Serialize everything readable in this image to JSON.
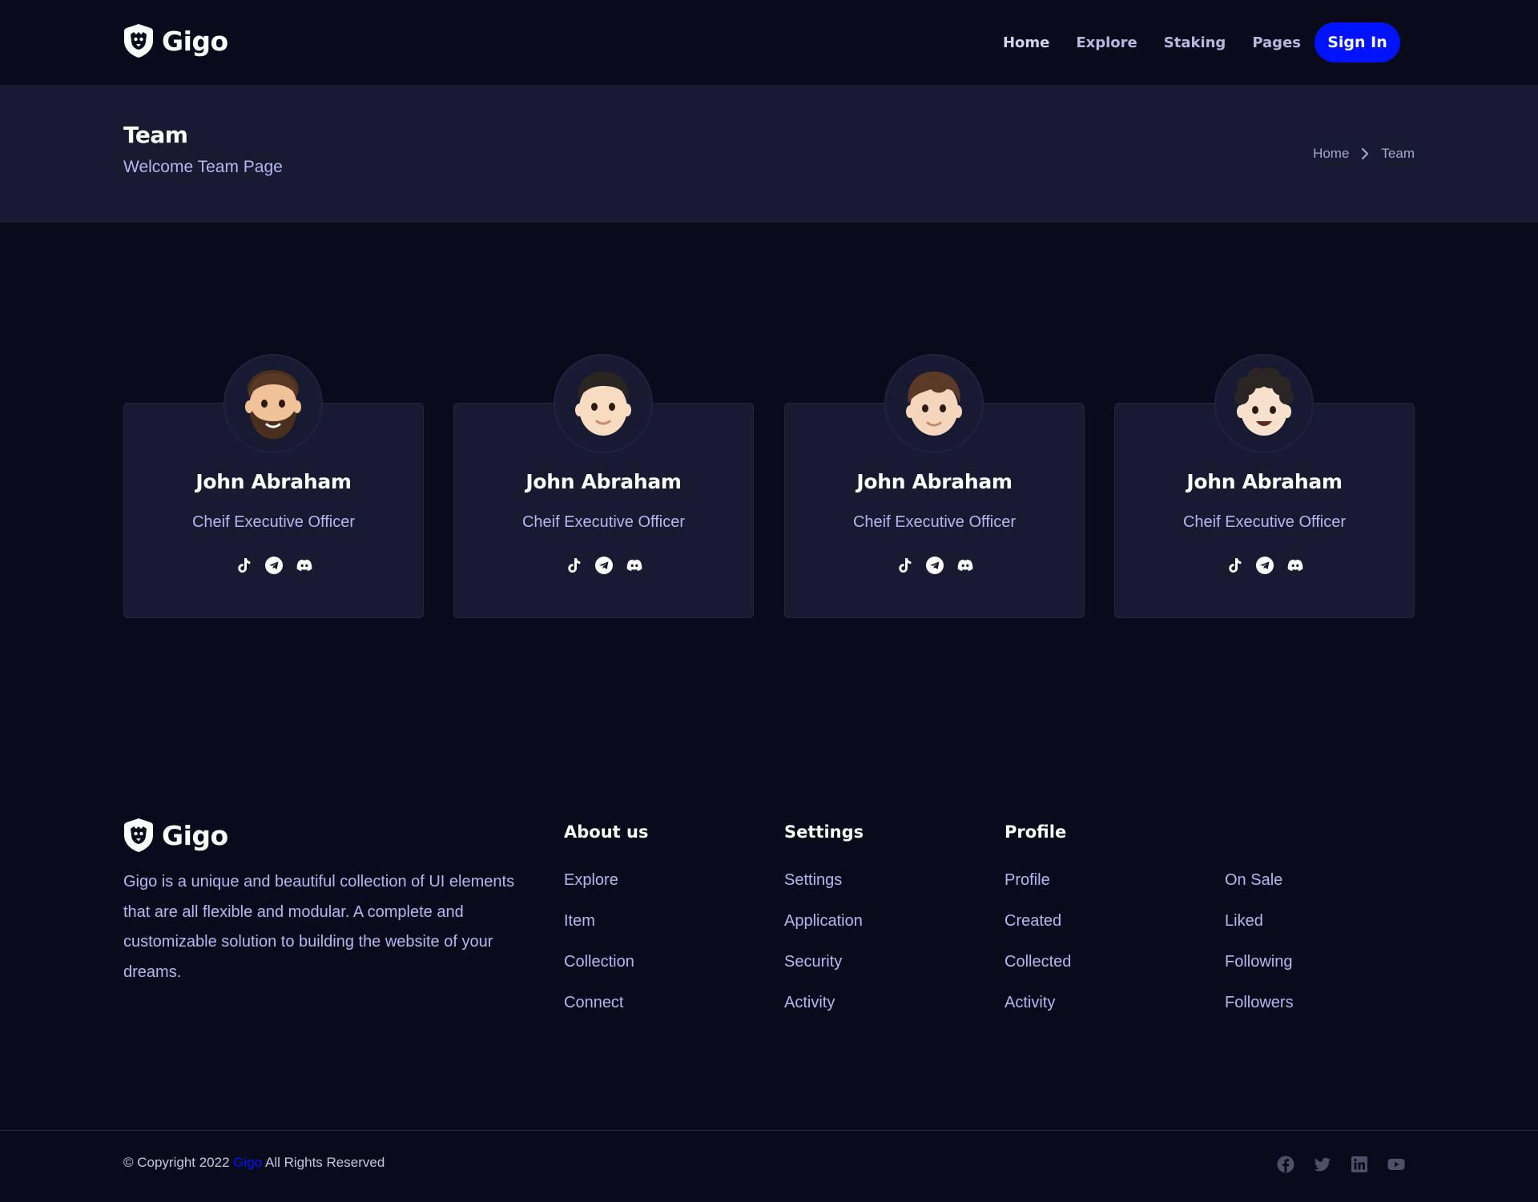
{
  "brand": {
    "name": "Gigo",
    "logo_icon": "lion-shield-icon"
  },
  "nav": {
    "items": [
      {
        "label": "Home"
      },
      {
        "label": "Explore"
      },
      {
        "label": "Staking"
      },
      {
        "label": "Pages"
      }
    ],
    "signin_label": "Sign In"
  },
  "banner": {
    "title": "Team",
    "subtitle": "Welcome Team Page",
    "breadcrumb": [
      "Home",
      "Team"
    ]
  },
  "team": {
    "members": [
      {
        "name": "John Abraham",
        "role": "Cheif Executive Officer",
        "avatar": "bearded-man-emoji",
        "socials": [
          "tiktok-icon",
          "telegram-icon",
          "discord-icon"
        ]
      },
      {
        "name": "John Abraham",
        "role": "Cheif Executive Officer",
        "avatar": "man-emoji",
        "socials": [
          "tiktok-icon",
          "telegram-icon",
          "discord-icon"
        ]
      },
      {
        "name": "John Abraham",
        "role": "Cheif Executive Officer",
        "avatar": "boy-emoji",
        "socials": [
          "tiktok-icon",
          "telegram-icon",
          "discord-icon"
        ]
      },
      {
        "name": "John Abraham",
        "role": "Cheif Executive Officer",
        "avatar": "curly-man-emoji",
        "socials": [
          "tiktok-icon",
          "telegram-icon",
          "discord-icon"
        ]
      }
    ]
  },
  "footer": {
    "description": "Gigo is a unique and beautiful collection of UI elements that are all flexible and modular. A complete and customizable solution to building the website of your dreams.",
    "columns": [
      {
        "title": "About us",
        "links": [
          "Explore",
          "Item",
          "Collection",
          "Connect"
        ]
      },
      {
        "title": "Settings",
        "links": [
          "Settings",
          "Application",
          "Security",
          "Activity"
        ]
      },
      {
        "title": "Profile",
        "links": [
          "Profile",
          "Created",
          "Collected",
          "Activity"
        ]
      },
      {
        "title": "",
        "links": [
          "On Sale",
          "Liked",
          "Following",
          "Followers"
        ]
      }
    ],
    "copyright_prefix": "© Copyright 2022",
    "copyright_brand": "Gigo",
    "copyright_suffix": "All Rights Reserved",
    "socials": [
      "facebook-icon",
      "twitter-icon",
      "linkedin-icon",
      "youtube-icon"
    ]
  },
  "colors": {
    "background": "#090b1c",
    "panel": "#171a30",
    "accent": "#0013ff",
    "muted_text": "#b3b8f1"
  }
}
